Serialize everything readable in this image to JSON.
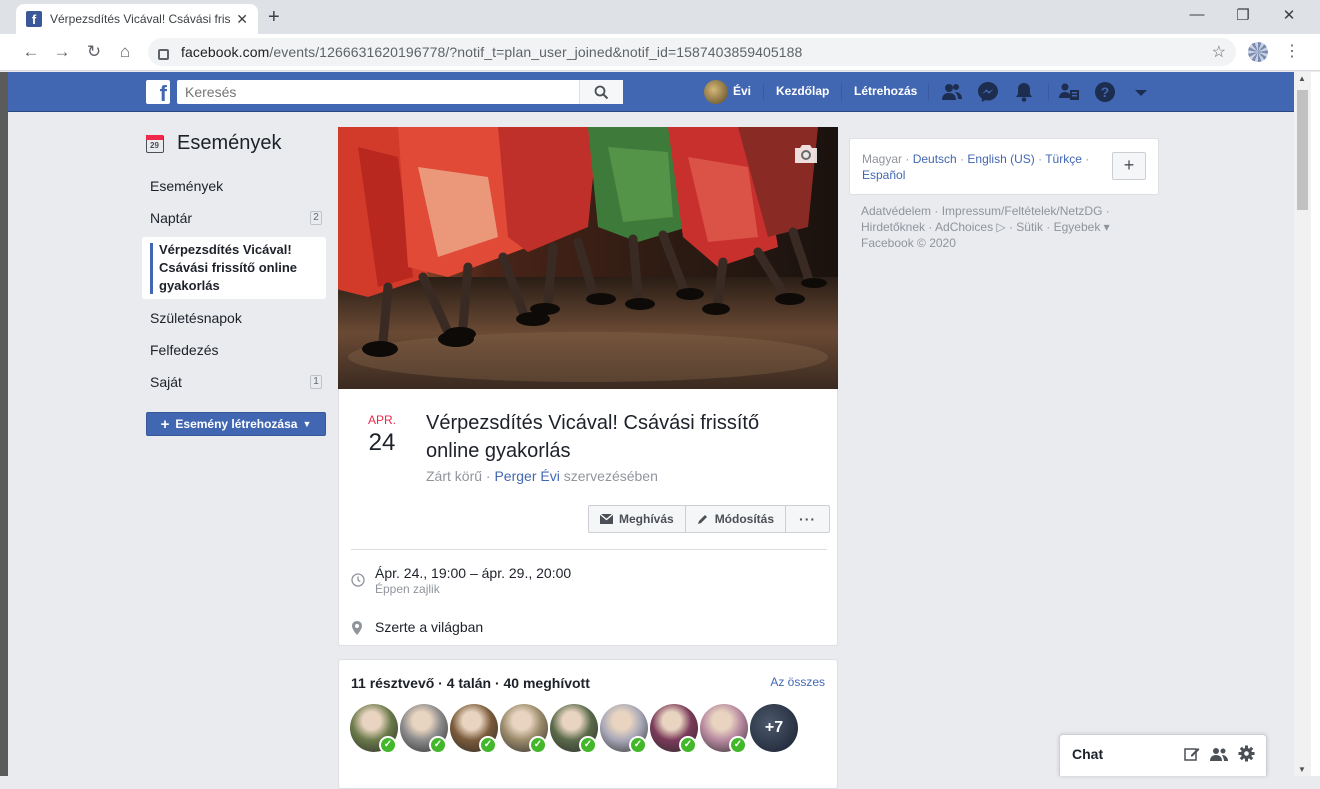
{
  "browser": {
    "tab_title": "Vérpezsdítés Vicával! Csávási frissítő online gyakorlás",
    "url_host": "facebook.com",
    "url_rest": "/events/1266631620196778/?notif_t=plan_user_joined&notif_id=1587403859405188"
  },
  "fb_header": {
    "search_placeholder": "Keresés",
    "user_name": "Évi",
    "home_label": "Kezdőlap",
    "create_label": "Létrehozás",
    "brand_color": "#4267b2"
  },
  "sidebar": {
    "title": "Események",
    "calendar_day": "29",
    "items": [
      {
        "label": "Események",
        "count": ""
      },
      {
        "label": "Naptár",
        "count": "2"
      },
      {
        "label": "Vérpezsdítés Vicával! Csávási frissítő online gyakorlás",
        "count": ""
      },
      {
        "label": "Születésnapok",
        "count": ""
      },
      {
        "label": "Felfedezés",
        "count": ""
      },
      {
        "label": "Saját",
        "count": "1"
      }
    ],
    "create_button": "Esemény létrehozása"
  },
  "event": {
    "month": "APR.",
    "day": "24",
    "title": "Vérpezsdítés Vicával! Csávási frissítő online gyakorlás",
    "privacy": "Zárt körű",
    "host": "Perger Évi",
    "host_suffix": "szervezésében",
    "invite_label": "Meghívás",
    "edit_label": "Módosítás",
    "more_label": "···",
    "time_main": "Ápr. 24., 19:00 – ápr. 29., 20:00",
    "time_sub": "Éppen zajlik",
    "location": "Szerte a világban"
  },
  "guests": {
    "summary": "11 résztvevő · 4 talán · 40 meghívott",
    "see_all": "Az összes",
    "more_count": "+7",
    "avatar_colors": [
      "#6b7a4a",
      "#8a8a8a",
      "#7a5a3a",
      "#9a8a6a",
      "#5a6a4a",
      "#a8a8b8",
      "#7a3a5a",
      "#b88aa0"
    ]
  },
  "right": {
    "current_lang": "Magyar",
    "langs": [
      "Deutsch",
      "English (US)",
      "Türkçe",
      "Español"
    ],
    "plus": "+",
    "footer_line1": "Adatvédelem · Impressum/Feltételek/NetzDG ·",
    "footer_line2": "Hirdetőknek · AdChoices ▷ · Sütik · Egyebek ▾",
    "copyright": "Facebook © 2020"
  },
  "chat": {
    "label": "Chat"
  }
}
